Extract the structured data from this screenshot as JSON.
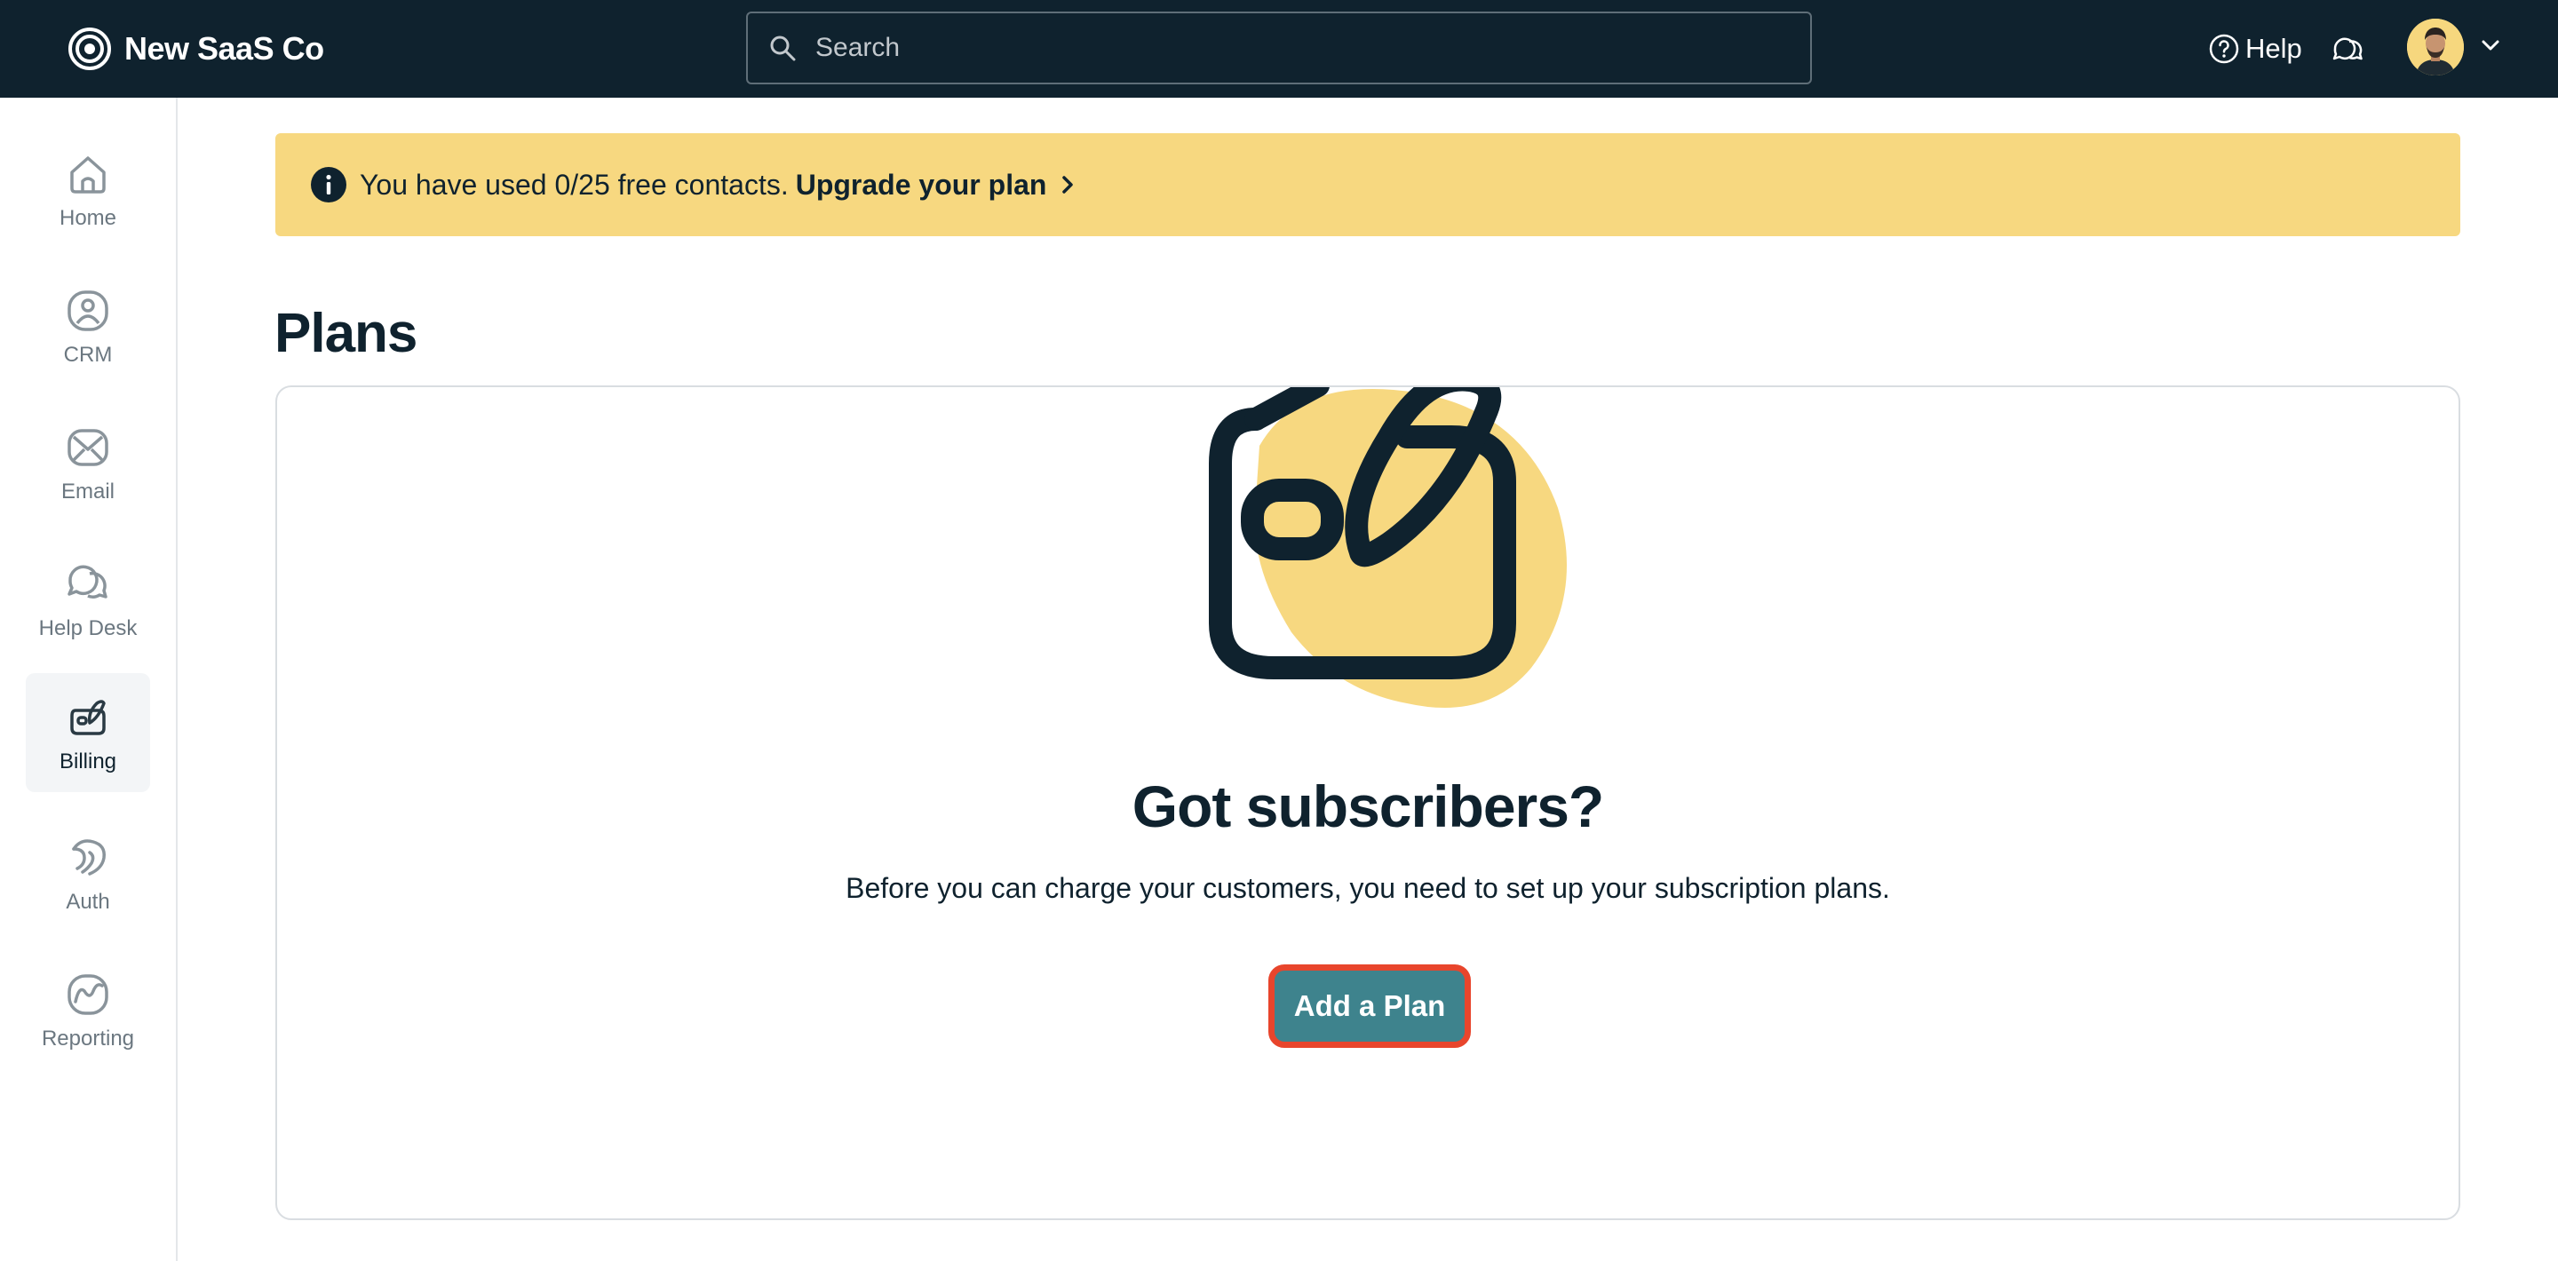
{
  "app": {
    "brand_name": "New SaaS Co"
  },
  "header": {
    "search_placeholder": "Search",
    "help_label": "Help"
  },
  "sidebar": {
    "items": [
      {
        "label": "Home",
        "icon": "home-icon",
        "active": false
      },
      {
        "label": "CRM",
        "icon": "user-circle-icon",
        "active": false
      },
      {
        "label": "Email",
        "icon": "envelope-icon",
        "active": false
      },
      {
        "label": "Help Desk",
        "icon": "chat-bubbles-icon",
        "active": false
      },
      {
        "label": "Billing",
        "icon": "wallet-icon",
        "active": true
      },
      {
        "label": "Auth",
        "icon": "fingerprint-icon",
        "active": false
      },
      {
        "label": "Reporting",
        "icon": "chart-line-icon",
        "active": false
      }
    ]
  },
  "banner": {
    "text": "You have used 0/25 free contacts.",
    "link": "Upgrade your plan"
  },
  "page": {
    "title": "Plans"
  },
  "empty_state": {
    "title": "Got subscribers?",
    "description": "Before you can charge your customers, you need to set up your subscription plans.",
    "button_label": "Add a Plan"
  },
  "colors": {
    "topbar": "#0f222e",
    "banner": "#f7d880",
    "primary_button": "#3e838d",
    "button_highlight": "#e8452c",
    "illustration_blob": "#f7d880"
  }
}
